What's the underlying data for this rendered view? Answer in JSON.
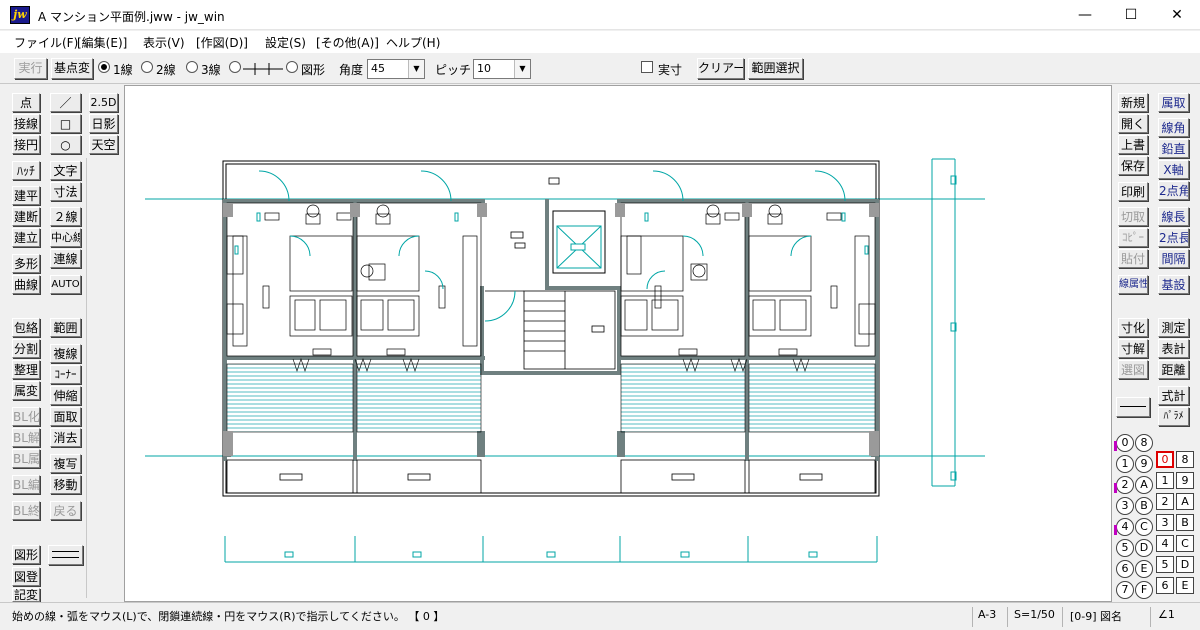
{
  "window": {
    "title": "A マンション平面例.jww - jw_win",
    "logo": "jw",
    "controls": {
      "minimize": "—",
      "maximize": "☐",
      "close": "✕"
    }
  },
  "menu": [
    "ファイル(F)",
    "[編集(E)]",
    "表示(V)",
    "[作図(D)]",
    "設定(S)",
    "[その他(A)]",
    "ヘルプ(H)"
  ],
  "toolbar": {
    "execute": "実行",
    "base_change": "基点変",
    "line_types": [
      "1線",
      "2線",
      "3線",
      "",
      "図形"
    ],
    "selected_line_type": "1線",
    "angle_label": "角度",
    "angle_value": "45",
    "pitch_label": "ピッチ",
    "pitch_value": "10",
    "actual_size_label": "実寸",
    "clear": "クリアー",
    "range_select": "範囲選択"
  },
  "left_tools": {
    "col1": [
      "点",
      "接線",
      "接円",
      "ﾊｯﾁ",
      "建平",
      "建断",
      "建立",
      "多形",
      "曲線",
      "包絡",
      "分割",
      "整理",
      "属変",
      "BL化",
      "BL解",
      "BL属",
      "BL編",
      "BL終",
      "図形",
      "図登",
      "記変"
    ],
    "col1_disabled": [
      "BL化",
      "BL解",
      "BL属",
      "BL編",
      "BL終"
    ],
    "col2": [
      "／",
      "□",
      "○",
      "文字",
      "寸法",
      "２線",
      "中心線",
      "連線",
      "AUTO",
      "範囲",
      "複線",
      "ｺｰﾅｰ",
      "伸縮",
      "面取",
      "消去",
      "複写",
      "移動",
      "戻る"
    ],
    "col2_disabled": [
      "戻る"
    ],
    "col3": [
      "2.5D",
      "日影",
      "天空"
    ]
  },
  "right_tools": {
    "col1": [
      "新規",
      "開く",
      "上書",
      "保存",
      "印刷",
      "切取",
      "ｺﾋﾟｰ",
      "貼付",
      "線属性",
      "寸化",
      "寸解",
      "選図",
      "",
      ""
    ],
    "col1_disabled": [
      "切取",
      "ｺﾋﾟｰ",
      "貼付",
      "選図"
    ],
    "col2": [
      "属取",
      "線角",
      "鉛直",
      "X軸",
      "2点角",
      "線長",
      "2点長",
      "間隔",
      "基設",
      "測定",
      "表計",
      "距離",
      "式計",
      "ﾊﾟﾗﾒ"
    ],
    "layers_left": [
      "0",
      "1",
      "2",
      "3",
      "4",
      "5",
      "6",
      "7"
    ],
    "layers_right": [
      "8",
      "9",
      "A",
      "B",
      "C",
      "D",
      "E",
      "F"
    ],
    "layers_left_pair": [
      [
        "0",
        "8"
      ],
      [
        "1",
        "9"
      ],
      [
        "2",
        "A"
      ],
      [
        "3",
        "B"
      ],
      [
        "4",
        "C"
      ],
      [
        "5",
        "D"
      ],
      [
        "6",
        "E"
      ],
      [
        "7",
        "F"
      ]
    ],
    "groups_col1": [
      "0",
      "1",
      "2",
      "3",
      "4",
      "5",
      "6",
      "7"
    ],
    "groups_col2": [
      "8",
      "9",
      "A",
      "B",
      "C",
      "D",
      "E",
      "F"
    ],
    "active_group": "0"
  },
  "status": {
    "message": "始めの線・弧をマウス(L)で、閉鎖連続線・円をマウス(R)で指示してください。 【 0 】",
    "paper": "A-3",
    "scale": "S=1/50",
    "layer_group": "[0-9] 図名",
    "angle_mark": "∠1"
  },
  "colors": {
    "wall": "#6f8080",
    "dim_line": "#00a6a6",
    "balcony_hatch": "#2aaeb4",
    "fill_gray": "#9a9a9a",
    "fixture": "#000000"
  }
}
